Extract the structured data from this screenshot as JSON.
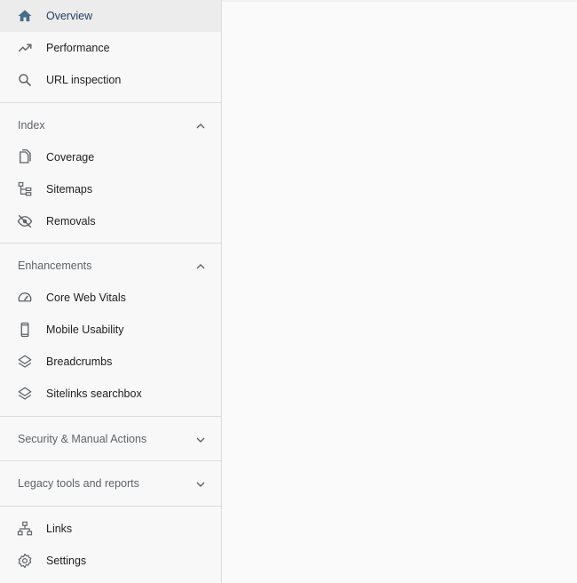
{
  "nav": {
    "overview": "Overview",
    "performance": "Performance",
    "url_inspection": "URL inspection"
  },
  "index": {
    "title": "Index",
    "coverage": "Coverage",
    "sitemaps": "Sitemaps",
    "removals": "Removals"
  },
  "enhancements": {
    "title": "Enhancements",
    "core_web_vitals": "Core Web Vitals",
    "mobile_usability": "Mobile Usability",
    "breadcrumbs": "Breadcrumbs",
    "sitelinks_searchbox": "Sitelinks searchbox"
  },
  "security": {
    "title": "Security & Manual Actions"
  },
  "legacy": {
    "title": "Legacy tools and reports"
  },
  "bottom": {
    "links": "Links",
    "settings": "Settings"
  },
  "colors": {
    "active_bg": "#ececec",
    "active_icon": "#4a6b8a",
    "icon": "#5f6368",
    "divider": "#dadce0"
  },
  "icons": {
    "overview": "home-icon",
    "performance": "trending-up-icon",
    "url_inspection": "search-icon",
    "coverage": "copy-pages-icon",
    "sitemaps": "sitemap-tree-icon",
    "removals": "eye-off-icon",
    "core_web_vitals": "speedometer-icon",
    "mobile_usability": "smartphone-icon",
    "breadcrumbs": "layers-icon",
    "sitelinks_searchbox": "layers-icon",
    "links": "network-icon",
    "settings": "gear-icon"
  }
}
